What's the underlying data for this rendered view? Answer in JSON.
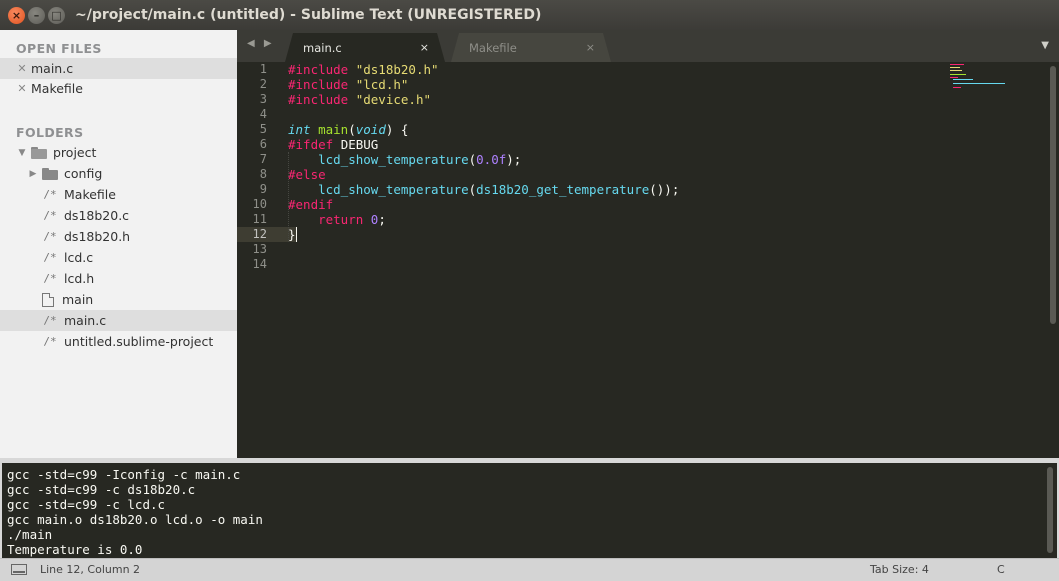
{
  "window": {
    "title": "~/project/main.c (untitled) - Sublime Text (UNREGISTERED)",
    "buttons": {
      "close": "×",
      "minimize": "–",
      "maximize": "□"
    }
  },
  "sidebar": {
    "open_files_heading": "OPEN FILES",
    "open_files": [
      {
        "name": "main.c",
        "selected": true
      },
      {
        "name": "Makefile",
        "selected": false
      }
    ],
    "folders_heading": "FOLDERS",
    "root": {
      "name": "project",
      "expanded": true
    },
    "children": [
      {
        "name": "config",
        "type": "folder"
      },
      {
        "name": "Makefile",
        "type": "text"
      },
      {
        "name": "ds18b20.c",
        "type": "text"
      },
      {
        "name": "ds18b20.h",
        "type": "text"
      },
      {
        "name": "lcd.c",
        "type": "text"
      },
      {
        "name": "lcd.h",
        "type": "text"
      },
      {
        "name": "main",
        "type": "binary"
      },
      {
        "name": "main.c",
        "type": "text",
        "selected": true
      },
      {
        "name": "untitled.sublime-project",
        "type": "text"
      }
    ],
    "text_file_glyph": "/*"
  },
  "tabs": [
    {
      "label": "main.c",
      "active": true,
      "close": "×"
    },
    {
      "label": "Makefile",
      "active": false,
      "close": "×"
    }
  ],
  "editor": {
    "line_numbers": [
      "1",
      "2",
      "3",
      "4",
      "5",
      "6",
      "7",
      "8",
      "9",
      "10",
      "11",
      "12",
      "13",
      "14"
    ],
    "current_line": 12,
    "lines": [
      [
        [
          "pp",
          "#include "
        ],
        [
          "str",
          "\"ds18b20.h\""
        ]
      ],
      [
        [
          "pp",
          "#include "
        ],
        [
          "str",
          "\"lcd.h\""
        ]
      ],
      [
        [
          "pp",
          "#include "
        ],
        [
          "str",
          "\"device.h\""
        ]
      ],
      [],
      [
        [
          "kw",
          "int "
        ],
        [
          "fn",
          "main"
        ],
        [
          "plain",
          "("
        ],
        [
          "kw",
          "void"
        ],
        [
          "plain",
          ") {"
        ]
      ],
      [
        [
          "pp",
          "#ifdef "
        ],
        [
          "plain",
          "DEBUG"
        ]
      ],
      [
        [
          "plain",
          "    "
        ],
        [
          "call",
          "lcd_show_temperature"
        ],
        [
          "plain",
          "("
        ],
        [
          "num",
          "0.0f"
        ],
        [
          "plain",
          ");"
        ]
      ],
      [
        [
          "pp",
          "#else"
        ]
      ],
      [
        [
          "plain",
          "    "
        ],
        [
          "call",
          "lcd_show_temperature"
        ],
        [
          "plain",
          "("
        ],
        [
          "call",
          "ds18b20_get_temperature"
        ],
        [
          "plain",
          "());"
        ]
      ],
      [
        [
          "pp",
          "#endif"
        ]
      ],
      [
        [
          "plain",
          "    "
        ],
        [
          "ret",
          "return "
        ],
        [
          "num",
          "0"
        ],
        [
          "plain",
          ";"
        ]
      ],
      [
        [
          "plain",
          "}"
        ]
      ],
      [],
      []
    ]
  },
  "console": {
    "lines": [
      "gcc -std=c99 -Iconfig -c main.c",
      "gcc -std=c99 -c ds18b20.c",
      "gcc -std=c99 -c lcd.c",
      "gcc main.o ds18b20.o lcd.o -o main",
      "./main",
      "Temperature is 0.0"
    ]
  },
  "statusbar": {
    "position": "Line 12, Column 2",
    "tab_size": "Tab Size: 4",
    "syntax": "C"
  },
  "colors": {
    "editor_bg": "#272822",
    "preprocessor": "#f92672",
    "string": "#e6db74",
    "keyword": "#66d9ef",
    "function": "#a6e22e",
    "number": "#ae81ff"
  }
}
